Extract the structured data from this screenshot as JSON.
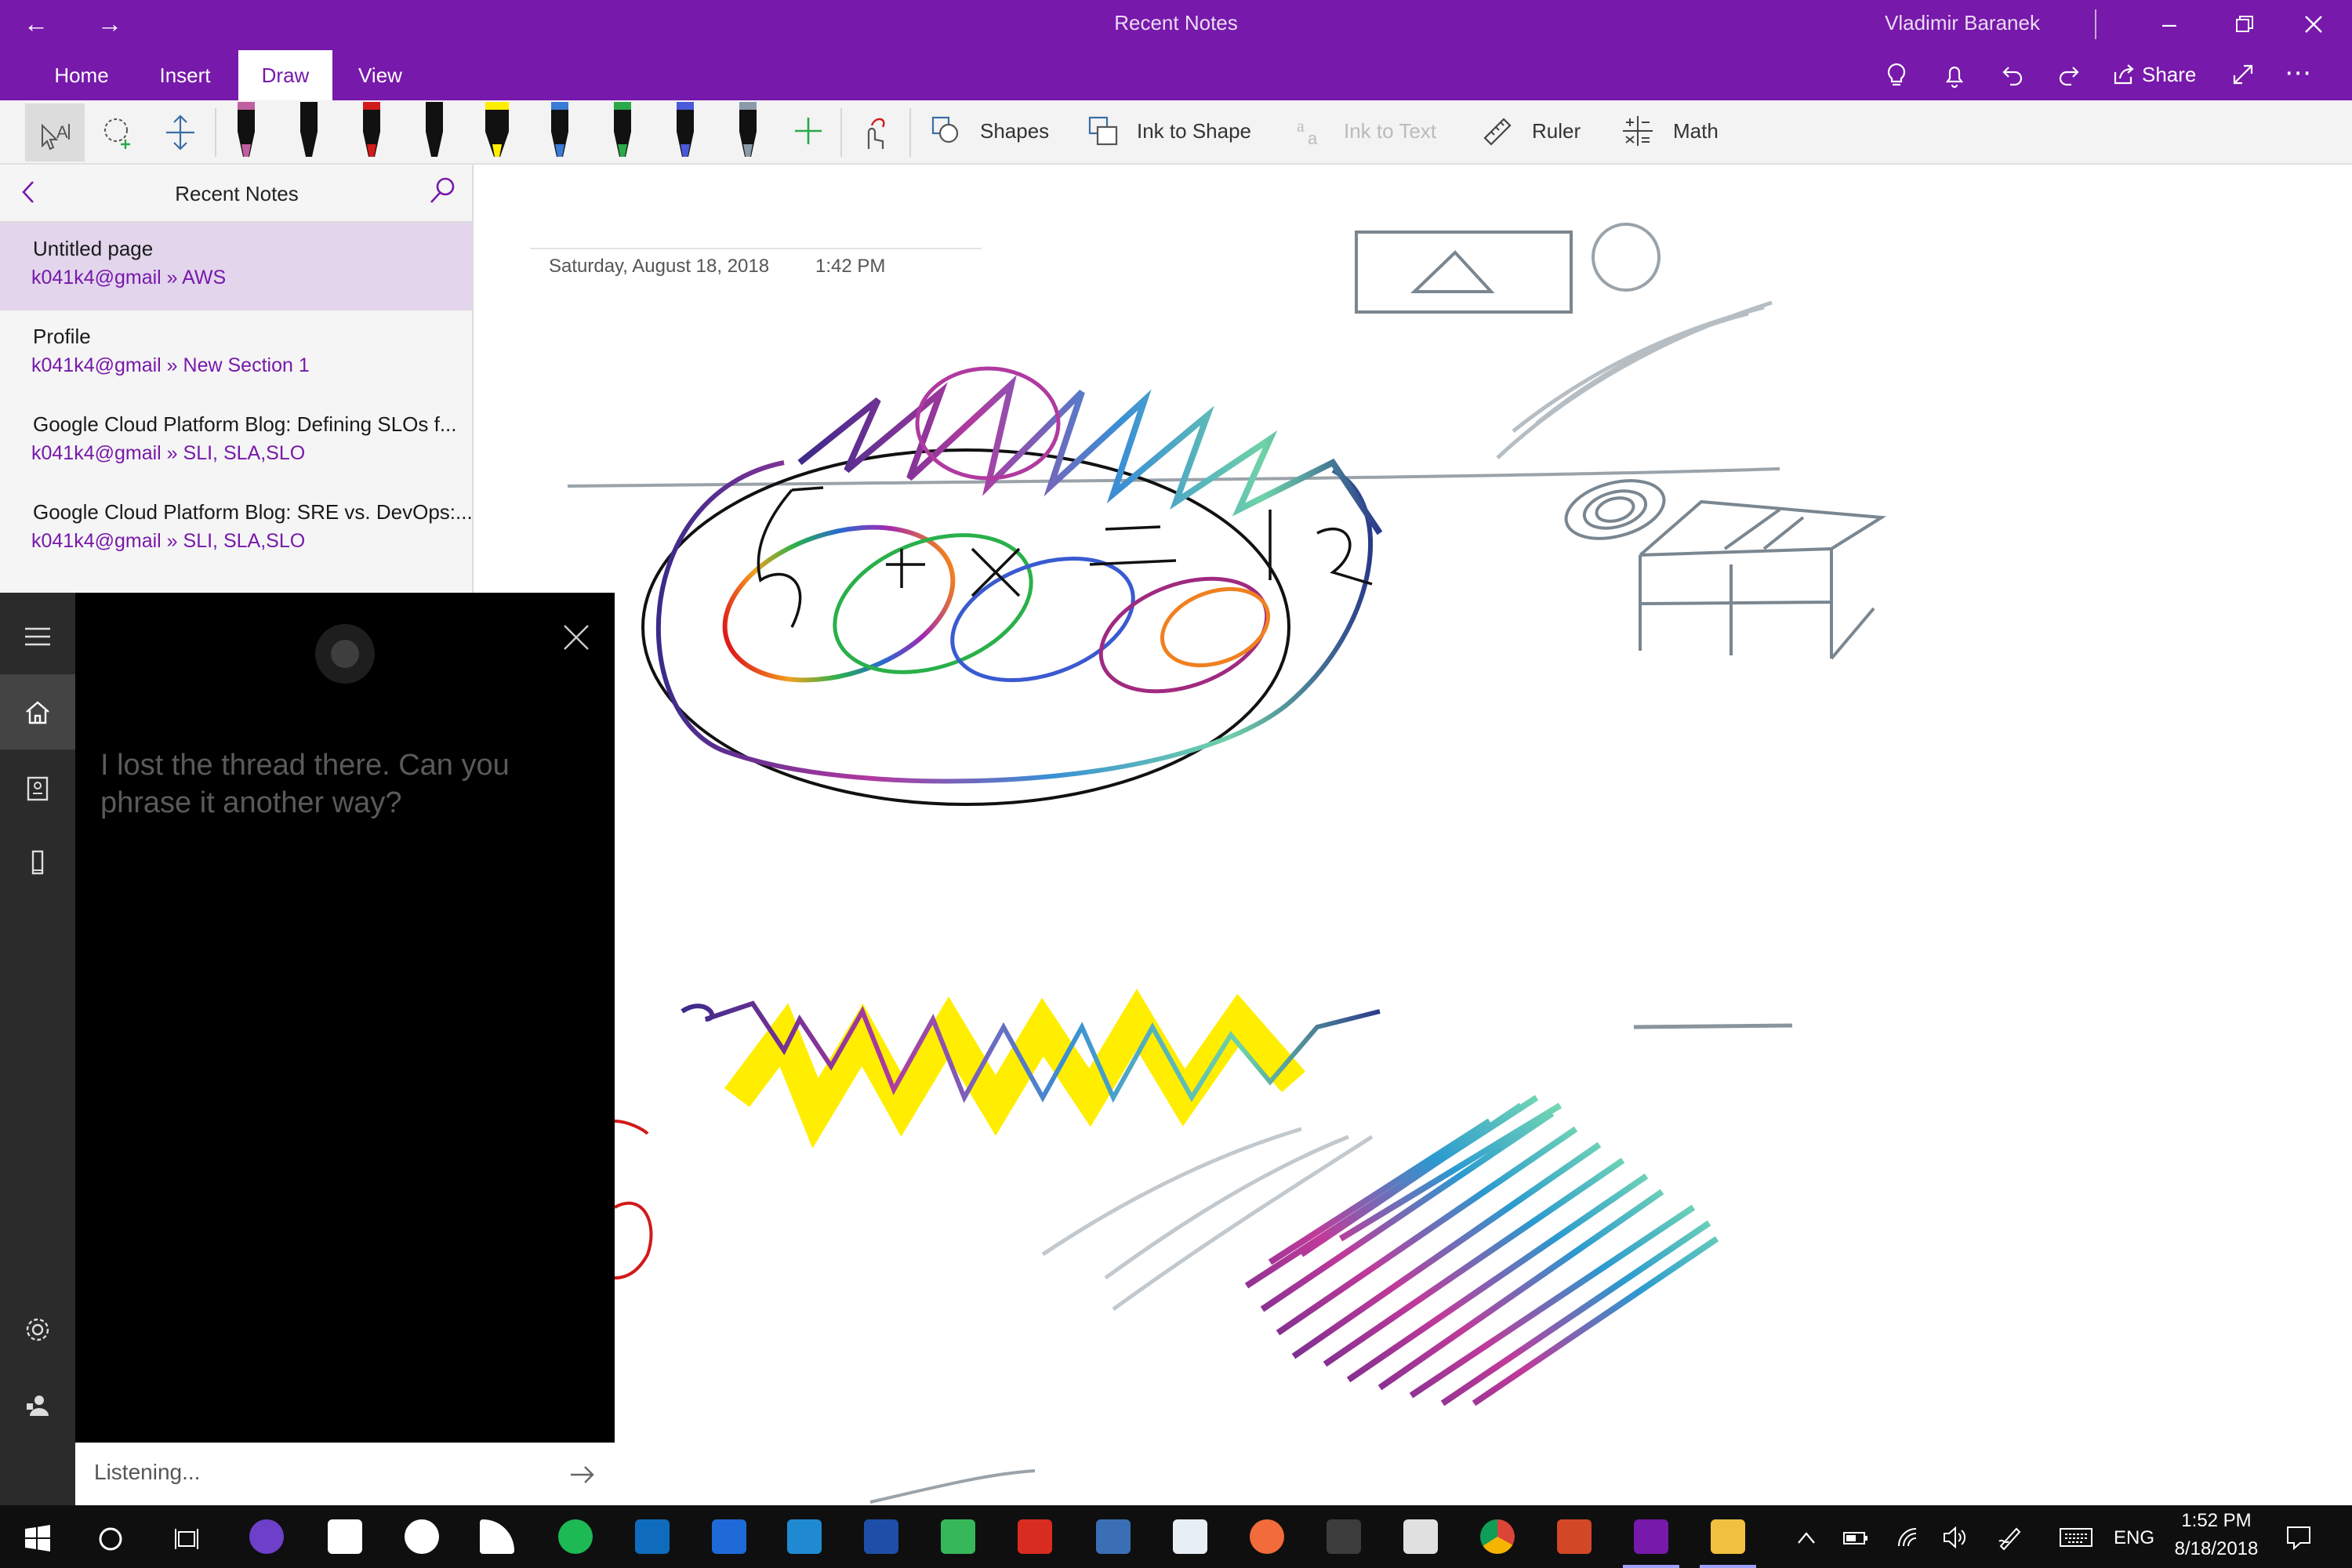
{
  "window": {
    "title": "Recent Notes",
    "user": "Vladimir Baranek"
  },
  "ribbon": {
    "tabs": [
      "Home",
      "Insert",
      "Draw",
      "View"
    ],
    "active_tab": "Draw",
    "share_label": "Share"
  },
  "draw_toolbar": {
    "shapes": "Shapes",
    "ink_to_shape": "Ink to Shape",
    "ink_to_text": "Ink to Text",
    "ruler": "Ruler",
    "math": "Math",
    "pens": [
      {
        "name": "pen-pink",
        "color": "#c060a0"
      },
      {
        "name": "pen-black-1",
        "color": "#111111"
      },
      {
        "name": "pen-red",
        "color": "#d11a1a"
      },
      {
        "name": "pen-black-2",
        "color": "#111111"
      },
      {
        "name": "highlighter-yellow",
        "color": "#ffee00"
      },
      {
        "name": "pen-galaxy",
        "color": "#3a7bd5"
      },
      {
        "name": "pen-rainbow",
        "color": "#2aa84a"
      },
      {
        "name": "pen-cosmos",
        "color": "#4a5ad8"
      },
      {
        "name": "pen-silver",
        "color": "#8a9aa8"
      }
    ]
  },
  "notes_pane": {
    "title": "Recent Notes",
    "notes": [
      {
        "title": "Untitled page",
        "path": "k041k4@gmail » AWS"
      },
      {
        "title": "Profile",
        "path": "k041k4@gmail » New Section 1"
      },
      {
        "title": "Google Cloud Platform Blog: Defining SLOs f...",
        "path": "k041k4@gmail » SLI, SLA,SLO"
      },
      {
        "title": "Google Cloud Platform Blog: SRE vs. DevOps:...",
        "path": "k041k4@gmail » SLI, SLA,SLO"
      }
    ]
  },
  "page": {
    "date": "Saturday, August 18, 2018",
    "time": "1:42 PM"
  },
  "cortana": {
    "message": "I lost the thread there. Can you phrase it another way?",
    "input_status": "Listening..."
  },
  "taskbar": {
    "language": "ENG",
    "time": "1:52 PM",
    "date": "8/18/2018"
  },
  "colors": {
    "accent": "#7719aa",
    "selected_note": "#e2d5ec",
    "cortana_bg": "#000000"
  }
}
